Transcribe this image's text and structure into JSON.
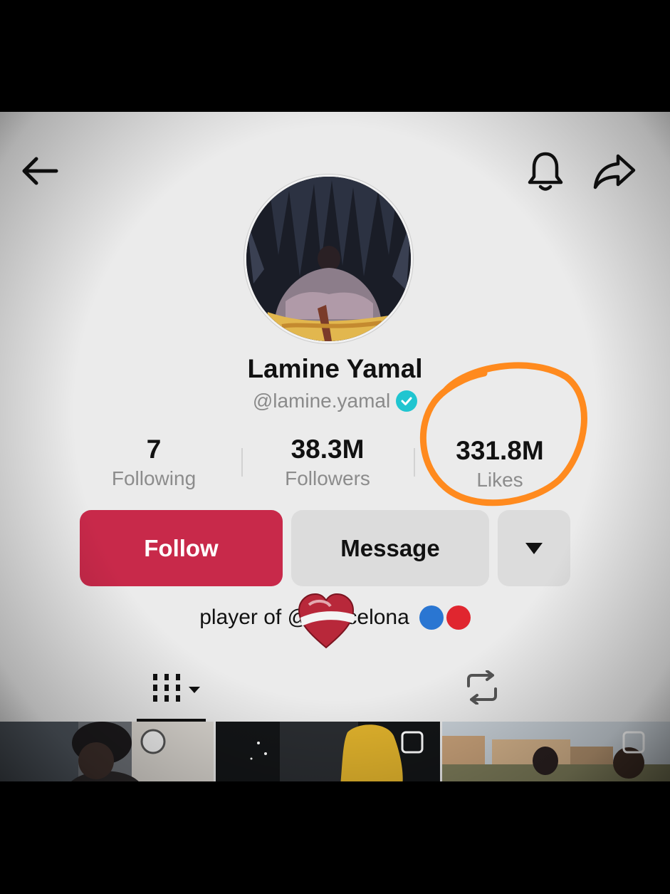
{
  "header": {
    "back_icon": "arrow-left-icon",
    "bell_icon": "bell-icon",
    "share_icon": "share-arrow-icon"
  },
  "profile": {
    "name": "Lamine Yamal",
    "handle": "@lamine.yamal",
    "verified_icon": "verified-check-icon"
  },
  "stats": [
    {
      "value": "7",
      "label": "Following"
    },
    {
      "value": "38.3M",
      "label": "Followers"
    },
    {
      "value": "331.8M",
      "label": "Likes"
    }
  ],
  "actions": {
    "follow_label": "Follow",
    "message_label": "Message",
    "more_icon": "caret-down-icon"
  },
  "bio": {
    "prefix": "player of @f",
    "suffix": "celona",
    "emoji_overlay": "heart-sticker",
    "ball_colors": [
      "#2a76d2",
      "#e0262f"
    ]
  },
  "tabs": {
    "videos_icon": "grid-icon",
    "reposts_icon": "repost-icon"
  },
  "colors": {
    "follow": "#c8294a",
    "verified": "#20c5d0",
    "annotation": "#ff8a1e"
  }
}
